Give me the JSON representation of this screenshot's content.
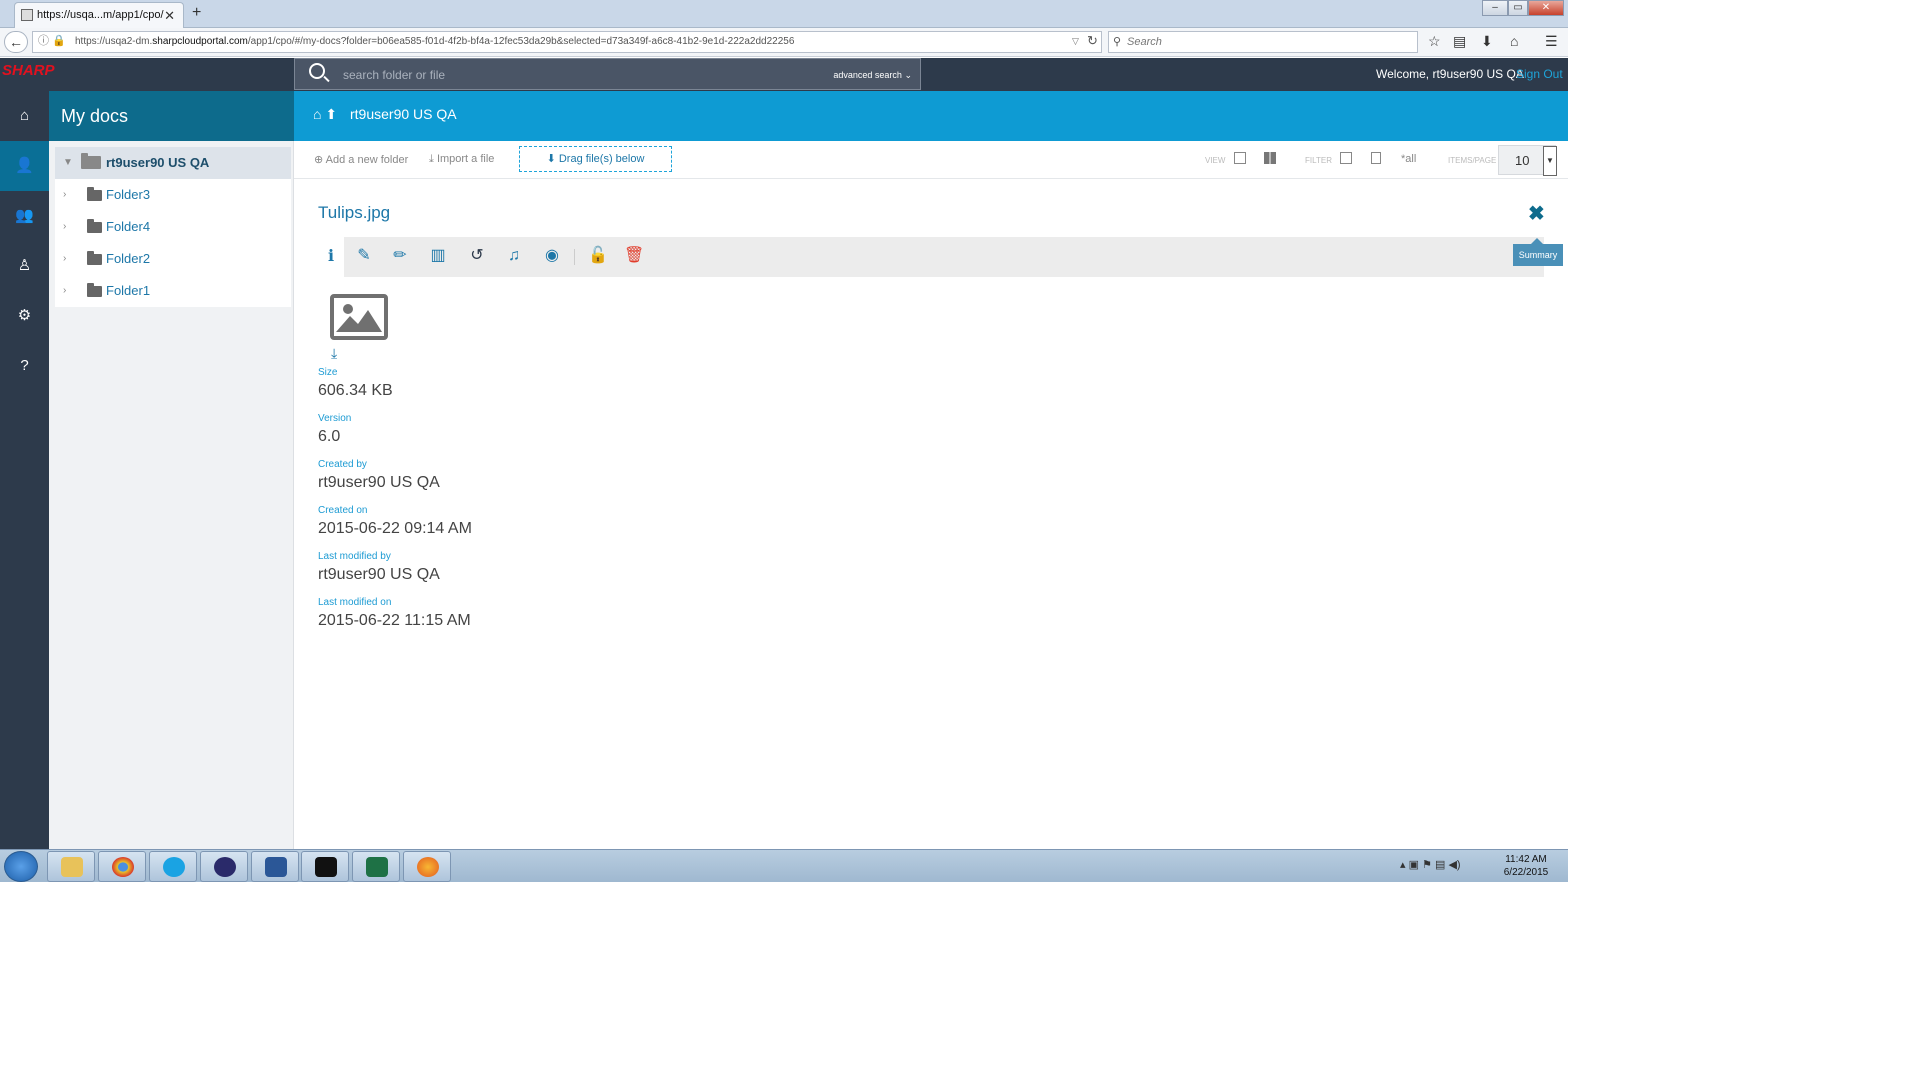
{
  "browser": {
    "tab_title": "https://usqa...m/app1/cpo/",
    "url_prefix": "https://usqa2-dm.",
    "url_host": "sharpcloudportal.com",
    "url_rest": "/app1/cpo/#/my-docs?folder=b06ea585-f01d-4f2b-bf4a-12fec53da29b&selected=d73a349f-a6c8-41b2-9e1d-222a2dd22256",
    "search_placeholder": "Search"
  },
  "header": {
    "logo": "SHARP",
    "search_placeholder": "search folder or file",
    "advanced_search": "advanced search",
    "welcome": "Welcome, rt9user90 US QA",
    "sign_out": "Sign Out"
  },
  "sidebar": {
    "title": "My docs",
    "root": "rt9user90 US QA",
    "folders": [
      "Folder3",
      "Folder4",
      "Folder2",
      "Folder1"
    ]
  },
  "breadcrumb": {
    "label": "rt9user90 US QA"
  },
  "toolbar": {
    "add_folder": "Add a new folder",
    "import_file": "Import a file",
    "drag_files": "Drag file(s) below",
    "view_label": "VIEW",
    "filter_label": "FILTER",
    "filter_all": "*all",
    "items_per_page_label": "ITEMS/PAGE",
    "items_per_page": "10"
  },
  "detail": {
    "file_name": "Tulips.jpg",
    "summary_tooltip": "Summary",
    "properties": [
      {
        "label": "Size",
        "value": "606.34 KB"
      },
      {
        "label": "Version",
        "value": "6.0"
      },
      {
        "label": "Created by",
        "value": "rt9user90 US QA"
      },
      {
        "label": "Created on",
        "value": "2015-06-22 09:14 AM"
      },
      {
        "label": "Last modified by",
        "value": "rt9user90 US QA"
      },
      {
        "label": "Last modified on",
        "value": "2015-06-22 11:15 AM"
      }
    ]
  },
  "taskbar": {
    "time": "11:42 AM",
    "date": "6/22/2015"
  },
  "colors": {
    "header": "#2d3a4b",
    "accent": "#0e9bd3",
    "sidebar_head": "#0d6b8c",
    "link": "#1d77a8",
    "danger": "#e13c2b"
  }
}
